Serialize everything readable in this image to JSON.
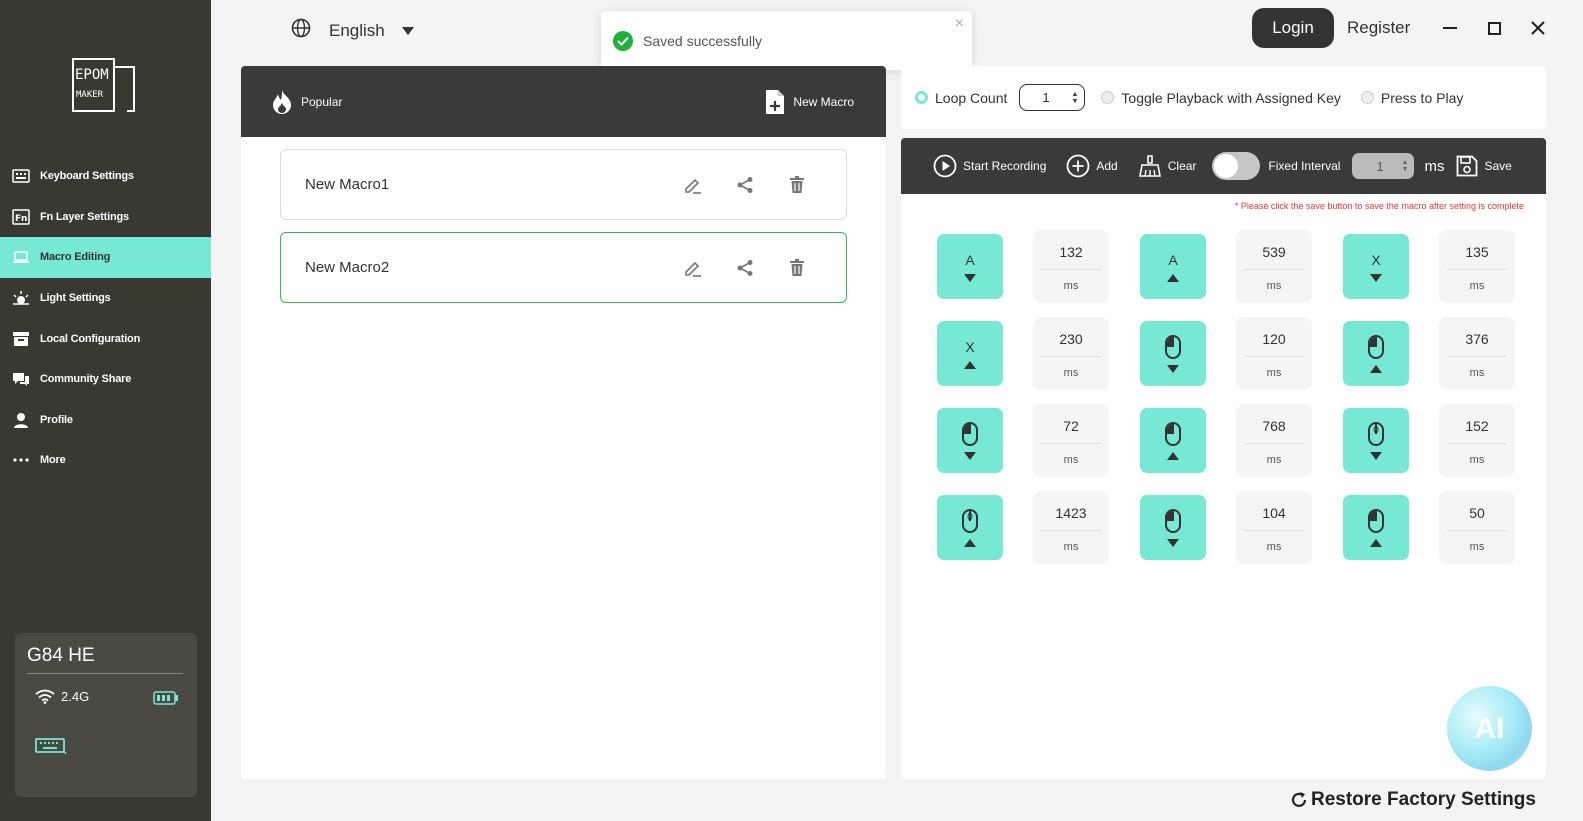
{
  "brand": {
    "logo_text_top": "EPOM",
    "logo_text_bottom": "MAKER"
  },
  "sidebar": {
    "items": [
      {
        "label": "Keyboard Settings",
        "icon": "keyboard-icon",
        "active": false
      },
      {
        "label": "Fn Layer Settings",
        "icon": "fn-icon",
        "active": false
      },
      {
        "label": "Macro Editing",
        "icon": "laptop-icon",
        "active": true
      },
      {
        "label": "Light Settings",
        "icon": "sun-icon",
        "active": false
      },
      {
        "label": "Local Configuration",
        "icon": "archive-icon",
        "active": false
      },
      {
        "label": "Community Share",
        "icon": "chat-icon",
        "active": false
      },
      {
        "label": "Profile",
        "icon": "user-icon",
        "active": false
      },
      {
        "label": "More",
        "icon": "more-icon",
        "active": false
      }
    ]
  },
  "device": {
    "name": "G84 HE",
    "connection": "2.4G"
  },
  "header": {
    "language": "English",
    "login": "Login",
    "register": "Register"
  },
  "toast": {
    "message": "Saved successfully",
    "close": "×"
  },
  "macro_list": {
    "popular": "Popular",
    "new_macro": "New Macro",
    "items": [
      {
        "name": "New Macro1",
        "selected": false
      },
      {
        "name": "New Macro2",
        "selected": true
      }
    ]
  },
  "options": {
    "loop_count_label": "Loop Count",
    "loop_count_value": "1",
    "toggle_playback_label": "Toggle Playback with Assigned Key",
    "press_to_play_label": "Press to Play"
  },
  "toolbar": {
    "start_recording": "Start Recording",
    "add": "Add",
    "clear": "Clear",
    "fixed_interval": "Fixed Interval",
    "interval_value": "1",
    "interval_unit": "ms",
    "save": "Save"
  },
  "warning": "* Please click the save button to save the macro after setting is complete",
  "events": [
    {
      "kind": "key",
      "label": "A",
      "dir": "down",
      "delay": "132"
    },
    {
      "kind": "key",
      "label": "A",
      "dir": "up",
      "delay": "539"
    },
    {
      "kind": "key",
      "label": "X",
      "dir": "down",
      "delay": "135"
    },
    {
      "kind": "key",
      "label": "X",
      "dir": "up",
      "delay": "230"
    },
    {
      "kind": "mouse",
      "label": "",
      "dir": "down",
      "delay": "120"
    },
    {
      "kind": "mouse",
      "label": "",
      "dir": "up",
      "delay": "376"
    },
    {
      "kind": "mouse",
      "label": "",
      "dir": "down",
      "delay": "72"
    },
    {
      "kind": "mouse",
      "label": "",
      "dir": "up",
      "delay": "768"
    },
    {
      "kind": "mouse",
      "label": "0",
      "dir": "down",
      "delay": "152"
    },
    {
      "kind": "mouse",
      "label": "0",
      "dir": "up",
      "delay": "1423"
    },
    {
      "kind": "mouse",
      "label": "",
      "dir": "down",
      "delay": "104"
    },
    {
      "kind": "mouse",
      "label": "",
      "dir": "up",
      "delay": "50"
    }
  ],
  "delay_unit": "ms",
  "ai_label": "AI",
  "restore": "Restore Factory Settings",
  "colors": {
    "accent": "#76e8d4",
    "sidebar": "#393932",
    "dark_bar": "#3a3a38",
    "success": "#1fb139",
    "warning": "#e03a3a"
  }
}
